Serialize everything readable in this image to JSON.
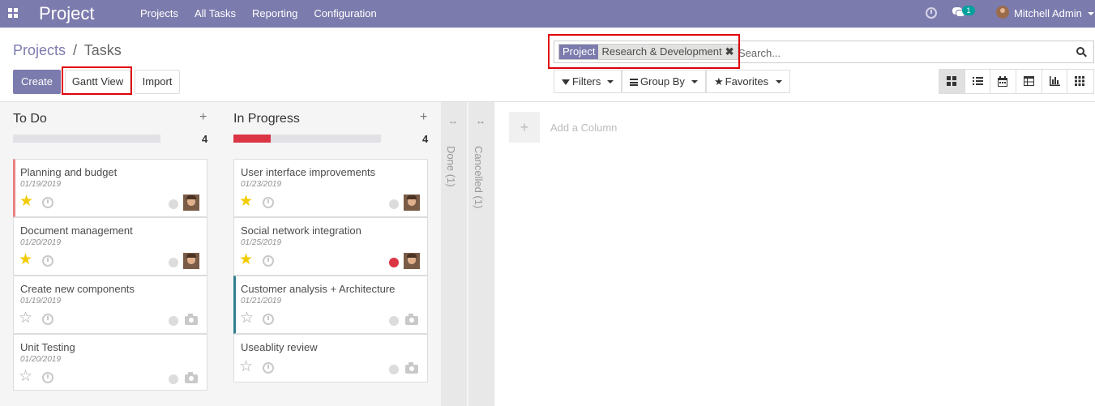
{
  "navbar": {
    "app_title": "Project",
    "menu": [
      "Projects",
      "All Tasks",
      "Reporting",
      "Configuration"
    ],
    "chat_count": "1",
    "user_name": "Mitchell Admin",
    "colors": {
      "bar": "#7c7bad",
      "badge": "#00a09d"
    }
  },
  "breadcrumb": {
    "parent": "Projects",
    "separator": "/",
    "current": "Tasks"
  },
  "buttons": {
    "create": "Create",
    "gantt": "Gantt View",
    "import": "Import"
  },
  "search": {
    "facet_category": "Project",
    "facet_value": "Research & Development",
    "placeholder": "Search..."
  },
  "filters": {
    "filters": "Filters",
    "group_by": "Group By",
    "favorites": "Favorites"
  },
  "views": [
    {
      "icon": "kanban-view-icon",
      "active": true
    },
    {
      "icon": "list-view-icon",
      "active": false
    },
    {
      "icon": "calendar-view-icon",
      "active": false
    },
    {
      "icon": "pivot-view-icon",
      "active": false
    },
    {
      "icon": "graph-view-icon",
      "active": false
    },
    {
      "icon": "grid-view-icon",
      "active": false
    }
  ],
  "columns": [
    {
      "name": "To Do",
      "count": "4",
      "progress_red": 0,
      "cards": [
        {
          "title": "Planning and budget",
          "date": "01/19/2019",
          "starred": true,
          "state": "grey",
          "assignee": "avatar",
          "border": "red"
        },
        {
          "title": "Document management",
          "date": "01/20/2019",
          "starred": true,
          "state": "grey",
          "assignee": "avatar",
          "border": ""
        },
        {
          "title": "Create new components",
          "date": "01/19/2019",
          "starred": false,
          "state": "grey",
          "assignee": "camera",
          "border": ""
        },
        {
          "title": "Unit Testing",
          "date": "01/20/2019",
          "starred": false,
          "state": "grey",
          "assignee": "camera",
          "border": ""
        }
      ]
    },
    {
      "name": "In Progress",
      "count": "4",
      "progress_red": 0.25,
      "cards": [
        {
          "title": "User interface improvements",
          "date": "01/23/2019",
          "starred": true,
          "state": "grey",
          "assignee": "avatar",
          "border": ""
        },
        {
          "title": "Social network integration",
          "date": "01/25/2019",
          "starred": true,
          "state": "red",
          "assignee": "avatar",
          "border": ""
        },
        {
          "title": "Customer analysis + Architecture",
          "date": "01/21/2019",
          "starred": false,
          "state": "grey",
          "assignee": "camera",
          "border": "teal"
        },
        {
          "title": "Useablity review",
          "date": "",
          "starred": false,
          "state": "grey",
          "assignee": "camera",
          "border": ""
        }
      ]
    }
  ],
  "folded_columns": [
    "Done (1)",
    "Cancelled (1)"
  ],
  "add_column": "Add a Column"
}
